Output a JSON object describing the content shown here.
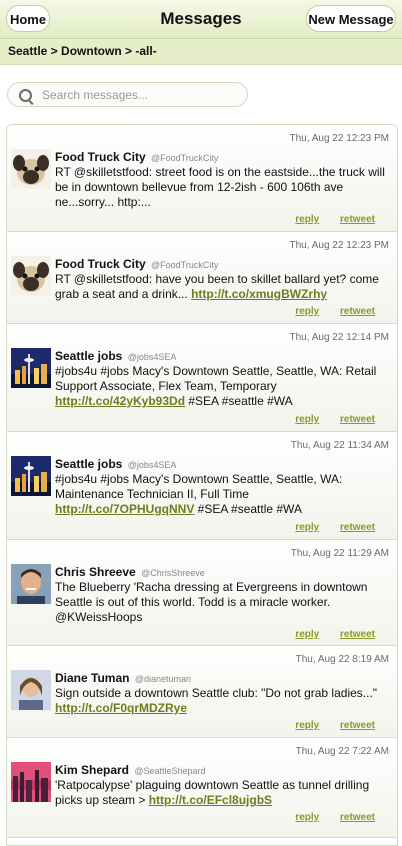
{
  "header": {
    "title": "Messages",
    "home_label": "Home",
    "new_message_label": "New Message"
  },
  "breadcrumb": "Seattle > Downtown > -all-",
  "search": {
    "placeholder": "Search messages..."
  },
  "actions": {
    "reply": "reply",
    "retweet": "retweet"
  },
  "messages": [
    {
      "time": "Thu, Aug 22 12:23 PM",
      "name": "Food Truck City",
      "handle": "@FoodTruckCity",
      "text": "RT @skilletstfood: street food is on the eastside...the truck will be in downtown bellevue from 12-2ish - 600 106th ave ne...sorry... http:...",
      "link": "",
      "after": "",
      "avatar": "pug-avatar"
    },
    {
      "time": "Thu, Aug 22 12:23 PM",
      "name": "Food Truck City",
      "handle": "@FoodTruckCity",
      "text": "RT @skilletstfood: have you been to skillet ballard yet? come grab a seat and a drink... ",
      "link": "http://t.co/xmugBWZrhy",
      "after": "",
      "avatar": "pug-avatar"
    },
    {
      "time": "Thu, Aug 22 12:14 PM",
      "name": "Seattle jobs",
      "handle": "@jobs4SEA",
      "text": "#jobs4u #jobs Macy's Downtown Seattle, Seattle, WA: Retail Support Associate, Flex Team, Temporary ",
      "link": "http://t.co/42yKyb93Dd",
      "after": " #SEA #seattle #WA",
      "avatar": "skyline-avatar"
    },
    {
      "time": "Thu, Aug 22 11:34 AM",
      "name": "Seattle jobs",
      "handle": "@jobs4SEA",
      "text": "#jobs4u #jobs Macy's Downtown Seattle, Seattle, WA: Maintenance Technician II, Full Time ",
      "link": "http://t.co/7OPHUgqNNV",
      "after": " #SEA #seattle #WA",
      "avatar": "skyline-avatar"
    },
    {
      "time": "Thu, Aug 22 11:29 AM",
      "name": "Chris Shreeve",
      "handle": "@ChrisShreeve",
      "text": "The Blueberry 'Racha dressing at Evergreens in downtown Seattle is out of this world. Todd is a miracle worker. @KWeissHoops",
      "link": "",
      "after": "",
      "avatar": "person-avatar"
    },
    {
      "time": "Thu, Aug 22 8:19 AM",
      "name": "Diane Tuman",
      "handle": "@dianetuman",
      "text": "Sign outside a downtown Seattle club: \"Do not grab ladies...\" ",
      "link": "http://t.co/F0qrMDZRye",
      "after": "",
      "avatar": "person-avatar"
    },
    {
      "time": "Thu, Aug 22 7:22 AM",
      "name": "Kim Shepard",
      "handle": "@SeattleShepard",
      "text": "'Ratpocalypse' plaguing downtown Seattle as tunnel drilling picks up steam > ",
      "link": "http://t.co/EFcl8ujgbS",
      "after": "",
      "avatar": "sunset-avatar"
    }
  ]
}
